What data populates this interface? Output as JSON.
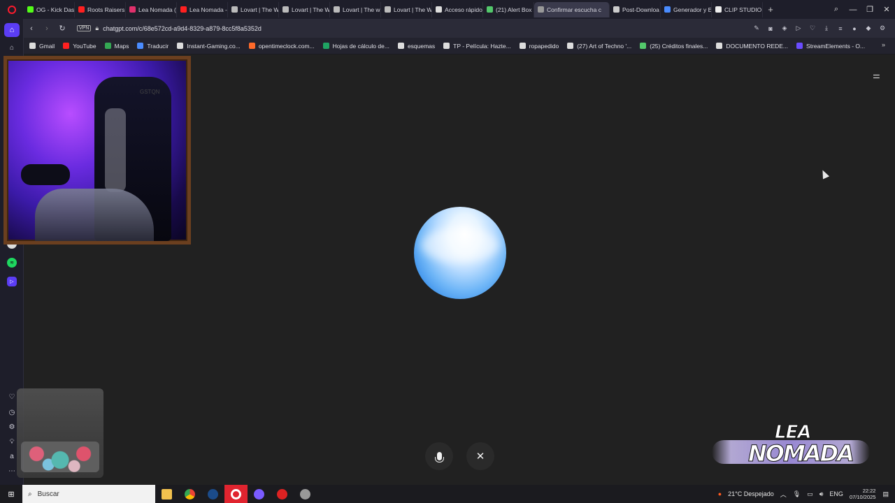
{
  "tabs": [
    {
      "label": "OG - Kick Dash",
      "color": "#53fc18"
    },
    {
      "label": "Roots Raisers",
      "color": "#ff2020"
    },
    {
      "label": "Lea Nomada (@",
      "color": "#e1306c"
    },
    {
      "label": "Lea Nomada -",
      "color": "#ff2020"
    },
    {
      "label": "Lovart | The W",
      "color": "#bbbbbb"
    },
    {
      "label": "Lovart | The W",
      "color": "#bbbbbb"
    },
    {
      "label": "Lovart | The w",
      "color": "#bbbbbb"
    },
    {
      "label": "Lovart | The W",
      "color": "#bbbbbb"
    },
    {
      "label": "Acceso rápido",
      "color": "#dddddd"
    },
    {
      "label": "(21) Alert Box /",
      "color": "#53c86b"
    },
    {
      "label": "Confirmar escucha c",
      "color": "#999999",
      "active": true
    },
    {
      "label": "Post-Downloa",
      "color": "#cccccc"
    },
    {
      "label": "Generador y E",
      "color": "#4a8cff"
    },
    {
      "label": "CLIP STUDIO P",
      "color": "#eeeeee"
    }
  ],
  "address": {
    "url": "chatgpt.com/c/68e572cd-a9d4-8329-a879-8cc5f8a5352d",
    "vpn": "VPN"
  },
  "bookmarks": [
    {
      "label": "Gmail",
      "color": "#dddddd"
    },
    {
      "label": "YouTube",
      "color": "#ff2020"
    },
    {
      "label": "Maps",
      "color": "#34a853"
    },
    {
      "label": "Traducir",
      "color": "#4a8cff"
    },
    {
      "label": "Instant-Gaming.co...",
      "color": "#dddddd"
    },
    {
      "label": "opentimeclock.com...",
      "color": "#ff6a2a"
    },
    {
      "label": "Hojas de cálculo de...",
      "color": "#1fa463"
    },
    {
      "label": "esquemas",
      "color": "#dddddd"
    },
    {
      "label": "TP - Película: Hazte...",
      "color": "#dddddd"
    },
    {
      "label": "ropapedido",
      "color": "#dddddd"
    },
    {
      "label": "(27) Art of Techno '...",
      "color": "#dddddd"
    },
    {
      "label": "(25) Créditos finales...",
      "color": "#53c86b"
    },
    {
      "label": "DOCUMENTO REDE...",
      "color": "#dddddd"
    },
    {
      "label": "StreamElements - O...",
      "color": "#6a4cff"
    }
  ],
  "webcam": {
    "brand": "GSTQN"
  },
  "logo": {
    "line1": "LEA",
    "line2": "NOMADA"
  },
  "taskbar": {
    "search_placeholder": "Buscar",
    "weather": "21°C  Despejado",
    "language": "ENG",
    "time": "22:22",
    "date": "07/10/2025"
  },
  "colors": {
    "background": "#212121",
    "orb_primary": "#3d92eb",
    "opera_red": "#ff1b2d",
    "sidebar_accent": "#5b3df5"
  }
}
